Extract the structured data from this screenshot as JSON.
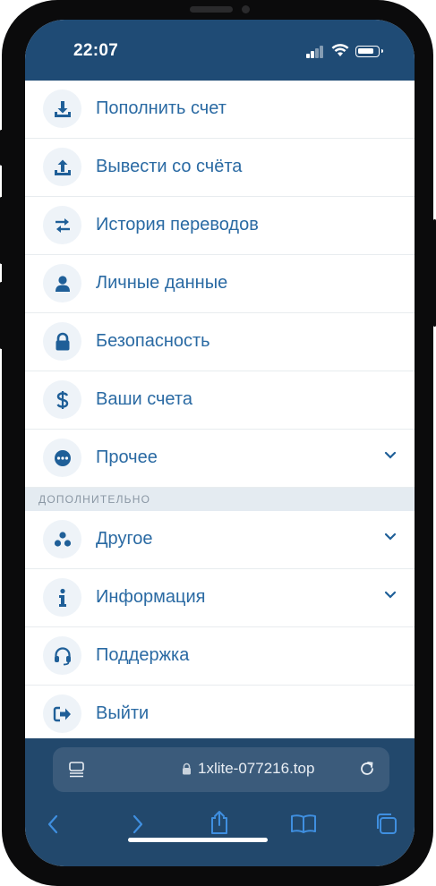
{
  "status_bar": {
    "time": "22:07"
  },
  "menu": {
    "items": [
      {
        "label": "Пополнить счет",
        "icon": "download-icon"
      },
      {
        "label": "Вывести со счёта",
        "icon": "upload-icon"
      },
      {
        "label": "История переводов",
        "icon": "transfer-arrows-icon"
      },
      {
        "label": "Личные данные",
        "icon": "user-icon"
      },
      {
        "label": "Безопасность",
        "icon": "lock-icon"
      },
      {
        "label": "Ваши счета",
        "icon": "dollar-icon"
      },
      {
        "label": "Прочее",
        "icon": "more-dots-icon",
        "expandable": true
      }
    ],
    "section_header": "ДОПОЛНИТЕЛЬНО",
    "extra_items": [
      {
        "label": "Другое",
        "icon": "three-circles-icon",
        "expandable": true
      },
      {
        "label": "Информация",
        "icon": "info-icon",
        "expandable": true
      },
      {
        "label": "Поддержка",
        "icon": "headset-icon"
      },
      {
        "label": "Выйти",
        "icon": "logout-icon"
      }
    ]
  },
  "browser": {
    "url": "1xlite-077216.top",
    "icons": [
      "reader-icon",
      "lock-icon",
      "reload-icon",
      "back-icon",
      "forward-icon",
      "share-icon",
      "bookmarks-icon",
      "tabs-icon"
    ]
  },
  "colors": {
    "header": "#1f4b75",
    "accent_text": "#2a6aa3",
    "icon_blue": "#1f5f98",
    "icon_bg": "#eef3f8",
    "section_bg": "#e4ebf1",
    "bottom_bar": "#22486c",
    "url_pill": "#3b5b7b"
  }
}
